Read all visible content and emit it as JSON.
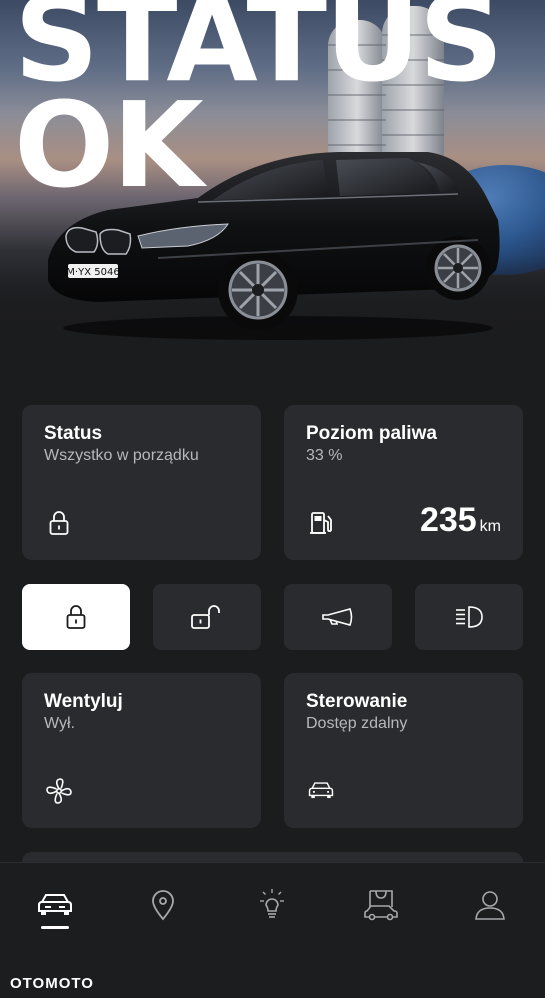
{
  "hero": {
    "title": "STATUS\nOK",
    "plate": "M·YX 5046"
  },
  "cards": {
    "status": {
      "title": "Status",
      "subtitle": "Wszystko w porządku",
      "icon": "lock-closed-icon"
    },
    "fuel": {
      "title": "Poziom paliwa",
      "subtitle": "33 %",
      "range_value": "235",
      "range_unit": "km",
      "icon": "fuel-pump-icon"
    },
    "ventilate": {
      "title": "Wentyluj",
      "subtitle": "Wył.",
      "icon": "fan-icon"
    },
    "remote": {
      "title": "Sterowanie",
      "subtitle": "Dostęp zdalny",
      "icon": "car-icon"
    }
  },
  "actions": [
    {
      "name": "lock",
      "icon": "lock-closed-icon",
      "active": true
    },
    {
      "name": "unlock",
      "icon": "lock-open-icon",
      "active": false
    },
    {
      "name": "horn",
      "icon": "horn-icon",
      "active": false
    },
    {
      "name": "lights",
      "icon": "headlight-icon",
      "active": false
    }
  ],
  "bottom_nav": [
    {
      "name": "vehicle",
      "icon": "car-front-icon",
      "active": true
    },
    {
      "name": "map",
      "icon": "location-pin-icon",
      "active": false
    },
    {
      "name": "ideas",
      "icon": "light-bulb-icon",
      "active": false
    },
    {
      "name": "shop",
      "icon": "shopping-bag-car-icon",
      "active": false
    },
    {
      "name": "profile",
      "icon": "person-icon",
      "active": false
    }
  ],
  "watermark": "OTOMOTO",
  "colors": {
    "background": "#1b1c1e",
    "card": "#2a2b2e",
    "text": "#ffffff",
    "subtext": "#b7b8bb",
    "active_button": "#ffffff"
  }
}
